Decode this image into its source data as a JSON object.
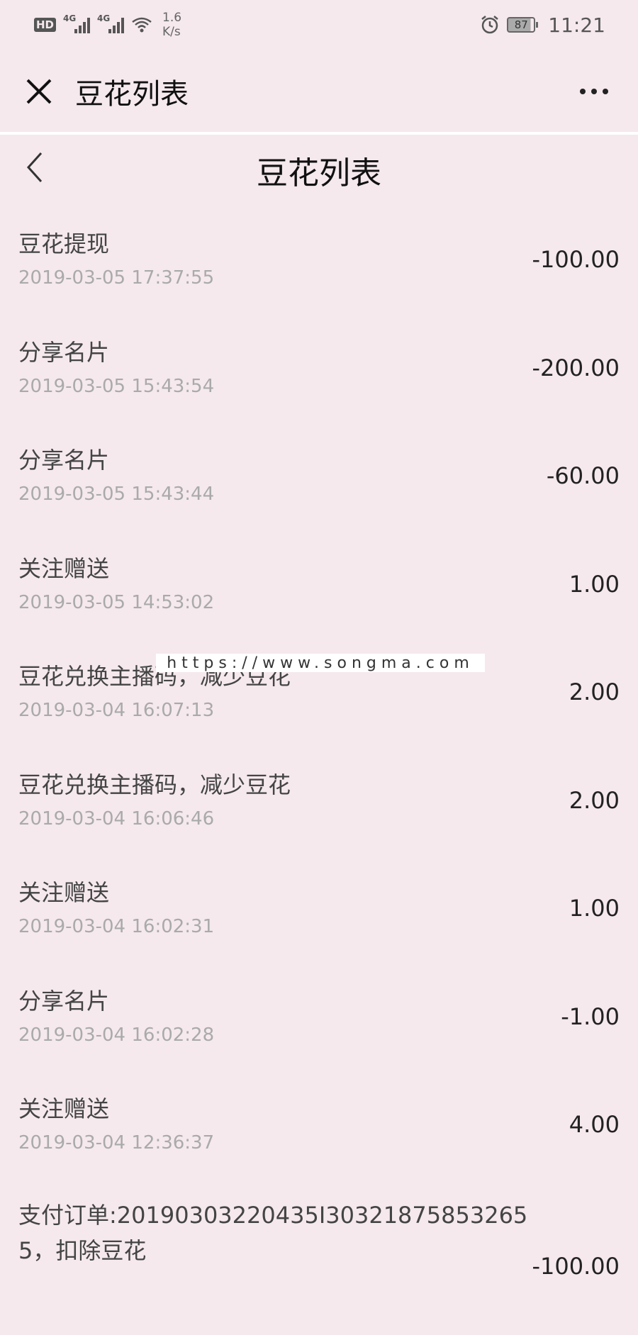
{
  "status_bar": {
    "hd": "HD",
    "network1": "4G",
    "network2": "4G",
    "speed_value": "1.6",
    "speed_unit": "K/s",
    "battery": "87",
    "time": "11:21",
    "icons": [
      "hd-icon",
      "signal-icon",
      "signal-icon",
      "wifi-icon",
      "alarm-icon",
      "battery-icon"
    ]
  },
  "window": {
    "title": "豆花列表",
    "close_icon": "close-icon",
    "more_icon": "more-icon"
  },
  "page": {
    "title": "豆花列表",
    "back_icon": "chevron-left-icon"
  },
  "records": [
    {
      "title": "豆花提现",
      "time": "2019-03-05 17:37:55",
      "amount": "-100.00"
    },
    {
      "title": "分享名片",
      "time": "2019-03-05 15:43:54",
      "amount": "-200.00"
    },
    {
      "title": "分享名片",
      "time": "2019-03-05 15:43:44",
      "amount": "-60.00"
    },
    {
      "title": "关注赠送",
      "time": "2019-03-05 14:53:02",
      "amount": "1.00"
    },
    {
      "title": "豆花兑换主播码，减少豆花",
      "time": "2019-03-04 16:07:13",
      "amount": "2.00"
    },
    {
      "title": "豆花兑换主播码，减少豆花",
      "time": "2019-03-04 16:06:46",
      "amount": "2.00"
    },
    {
      "title": "关注赠送",
      "time": "2019-03-04 16:02:31",
      "amount": "1.00"
    },
    {
      "title": "分享名片",
      "time": "2019-03-04 16:02:28",
      "amount": "-1.00"
    },
    {
      "title": "关注赠送",
      "time": "2019-03-04 12:36:37",
      "amount": "4.00"
    },
    {
      "title": "支付订单:20190303220435I303218758532655，扣除豆花",
      "time": "",
      "amount": "-100.00"
    }
  ],
  "watermark": "https://www.songma.com",
  "colors": {
    "background": "#f5e9ed",
    "time_text": "#aaaaaa"
  }
}
